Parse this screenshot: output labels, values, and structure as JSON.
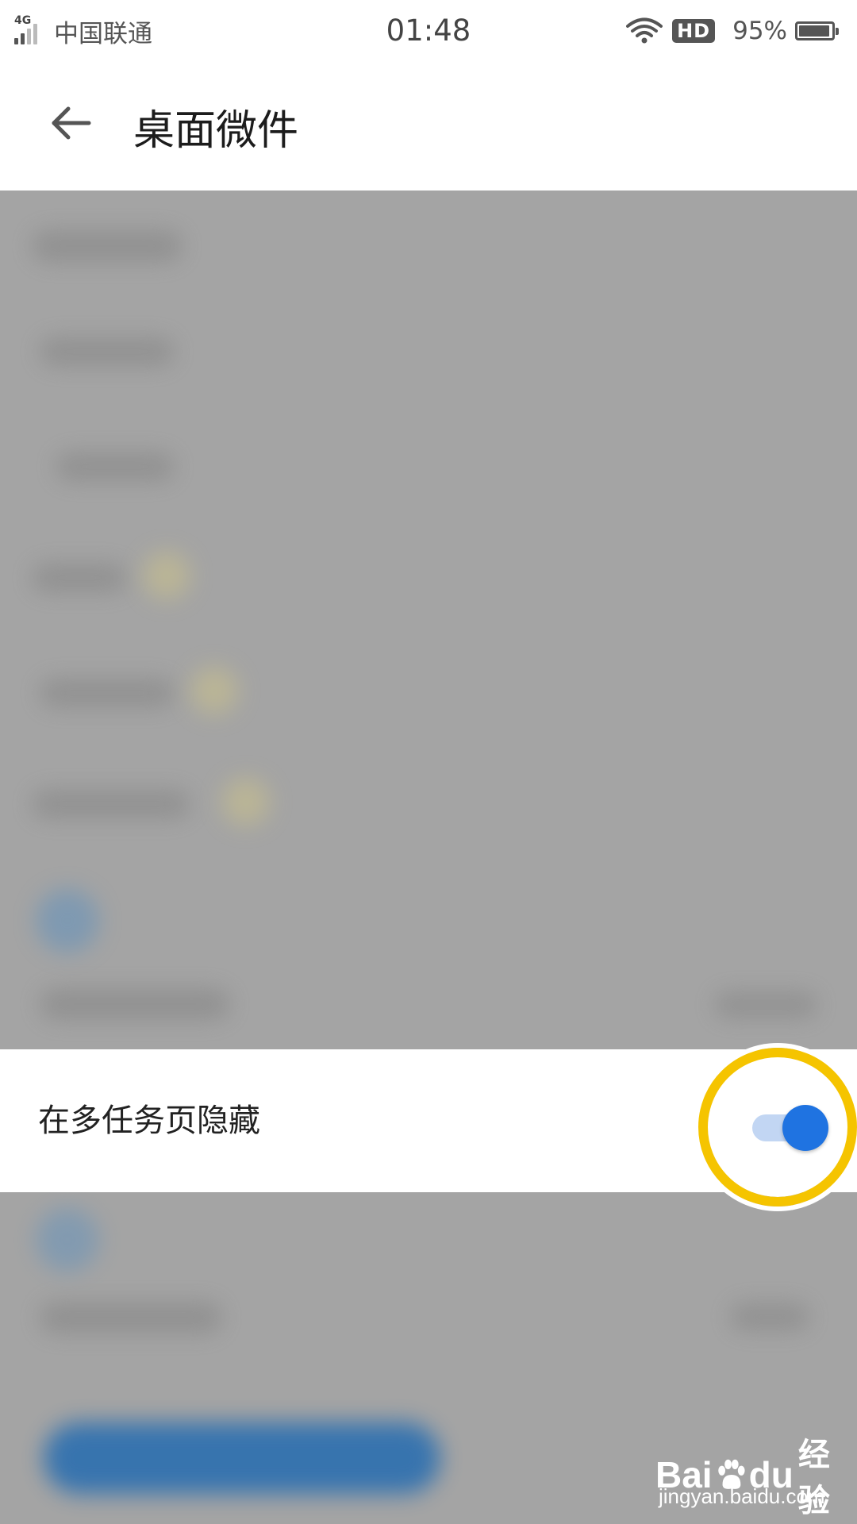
{
  "status_bar": {
    "network": "4G",
    "carrier": "中国联通",
    "time": "01:48",
    "hd_label": "HD",
    "battery_percent": "95%",
    "battery_level": 0.95
  },
  "header": {
    "title": "桌面微件",
    "back_icon": "arrow-left-icon"
  },
  "dialog": {
    "option_label": "在多任务页隐藏",
    "toggle_on": true,
    "accent_color": "#1f73e1",
    "highlight_color": "#f5c400"
  },
  "watermark": {
    "brand_left": "Bai",
    "brand_right": "du",
    "brand_suffix": "经验",
    "url": "jingyan.baidu.com"
  }
}
